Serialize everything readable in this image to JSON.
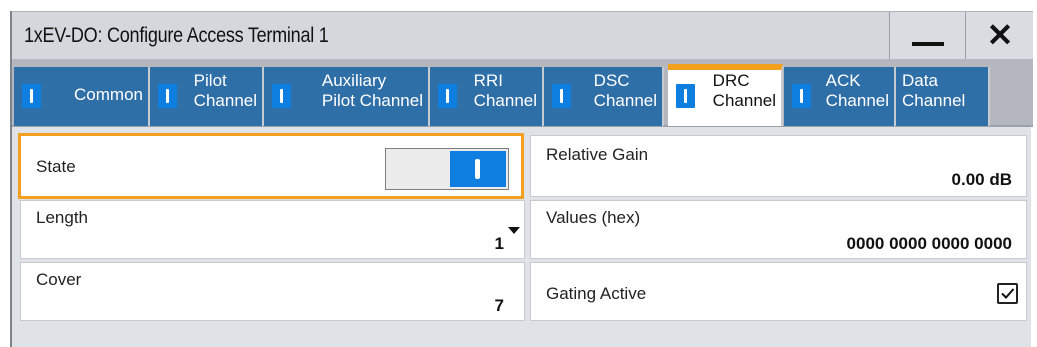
{
  "window": {
    "title": "1xEV-DO: Configure Access Terminal 1",
    "minimize_icon": "minimize-icon",
    "close_icon": "close-icon"
  },
  "tabs": [
    {
      "line1": "Common",
      "line2": "",
      "active": false
    },
    {
      "line1": "Pilot",
      "line2": "Channel",
      "active": false
    },
    {
      "line1": "Auxiliary",
      "line2": "Pilot Channel",
      "active": false
    },
    {
      "line1": "RRI",
      "line2": "Channel",
      "active": false
    },
    {
      "line1": "DSC",
      "line2": "Channel",
      "active": false
    },
    {
      "line1": "DRC",
      "line2": "Channel",
      "active": true
    },
    {
      "line1": "ACK",
      "line2": "Channel",
      "active": false
    },
    {
      "line1": "Data",
      "line2": "Channel",
      "active": false
    }
  ],
  "fields": {
    "state": {
      "label": "State",
      "on": true
    },
    "relative_gain": {
      "label": "Relative Gain",
      "value": "0.00 dB"
    },
    "length": {
      "label": "Length",
      "value": "1"
    },
    "values_hex": {
      "label": "Values (hex)",
      "value": "0000 0000 0000 0000"
    },
    "cover": {
      "label": "Cover",
      "value": "7"
    },
    "gating_active": {
      "label": "Gating Active",
      "checked": true
    }
  },
  "colors": {
    "accent": "#f2a01d",
    "tab_bg": "#2f6fa8",
    "indicator": "#0e7fe0",
    "panel_bg": "#dfe3e8"
  }
}
